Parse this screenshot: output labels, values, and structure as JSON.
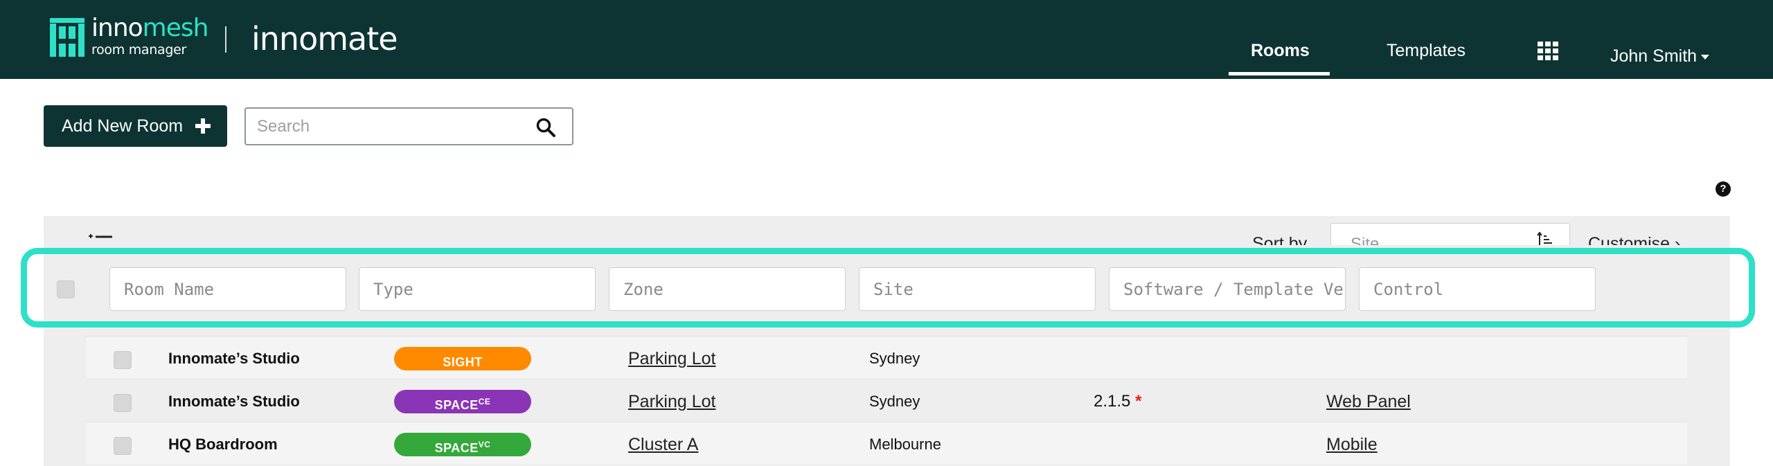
{
  "header": {
    "brand_prefix": "inno",
    "brand_suffix": "mesh",
    "brand_sub": "room manager",
    "product": "innomate",
    "tabs": [
      {
        "label": "Rooms",
        "active": true
      },
      {
        "label": "Templates",
        "active": false
      }
    ],
    "apps_icon": "grid-icon",
    "user": "John Smith",
    "bg_color": "#0d3433",
    "accent_color": "#2ee0c7"
  },
  "toolbar": {
    "add_label": "Add New Room",
    "search_placeholder": "Search"
  },
  "list": {
    "sort_label": "Sort by",
    "sort_value": "Site",
    "customise_label": "Customise ›"
  },
  "filters": {
    "room_name": "Room Name",
    "type": "Type",
    "zone": "Zone",
    "site": "Site",
    "software": "Software / Template Version",
    "control": "Control"
  },
  "rows": [
    {
      "name": "Innomate’s Studio",
      "type": "SIGHT",
      "type_sup": "",
      "type_color": "#ff8a00",
      "zone": "Parking Lot",
      "site": "Sydney",
      "software": "",
      "software_flag": "",
      "control": ""
    },
    {
      "name": "Innomate’s Studio",
      "type": "SPACE",
      "type_sup": "CE",
      "type_color": "#8a35b5",
      "zone": "Parking Lot",
      "site": "Sydney",
      "software": "2.1.5",
      "software_flag": "*",
      "control": "Web Panel"
    },
    {
      "name": "HQ Boardroom",
      "type": "SPACE",
      "type_sup": "VC",
      "type_color": "#34a83a",
      "zone": "Cluster A",
      "site": "Melbourne",
      "software": "",
      "software_flag": "",
      "control": "Mobile"
    }
  ]
}
